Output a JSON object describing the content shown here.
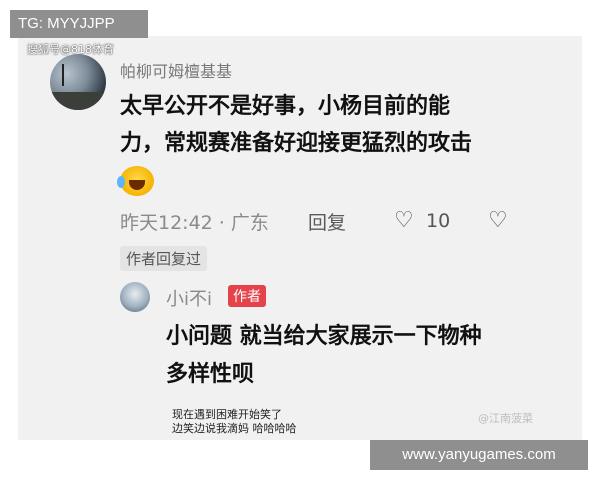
{
  "overlay": {
    "top_left_tag": "TG: MYYJJPP",
    "bottom_right_url": "www.yanyugames.com"
  },
  "post": {
    "source_mark": "搜狐号@818体育",
    "comment": {
      "username": "帕柳可姆檀基基",
      "text_line1": "太早公开不是好事，小杨目前的能",
      "text_line2": "力，常规赛准备好迎接更猛烈的攻击",
      "emoji_icon": "crying-laughing-emoji",
      "time": "昨天12:42 · 广东",
      "reply_label": "回复",
      "like_icon": "heart-icon",
      "like_count": "10",
      "dislike_icon": "broken-heart-icon",
      "author_replied_label": "作者回复过"
    },
    "reply": {
      "username": "小i不i",
      "badge": "作者",
      "text_line1": "小问题 就当给大家展示一下物种",
      "text_line2": "多样性呗"
    },
    "bottom_caption_line1": "现在遇到困难开始笑了",
    "bottom_caption_line2": "边笑边说我滴妈 哈哈哈哈",
    "watermark_right": "@江南菠菜"
  }
}
